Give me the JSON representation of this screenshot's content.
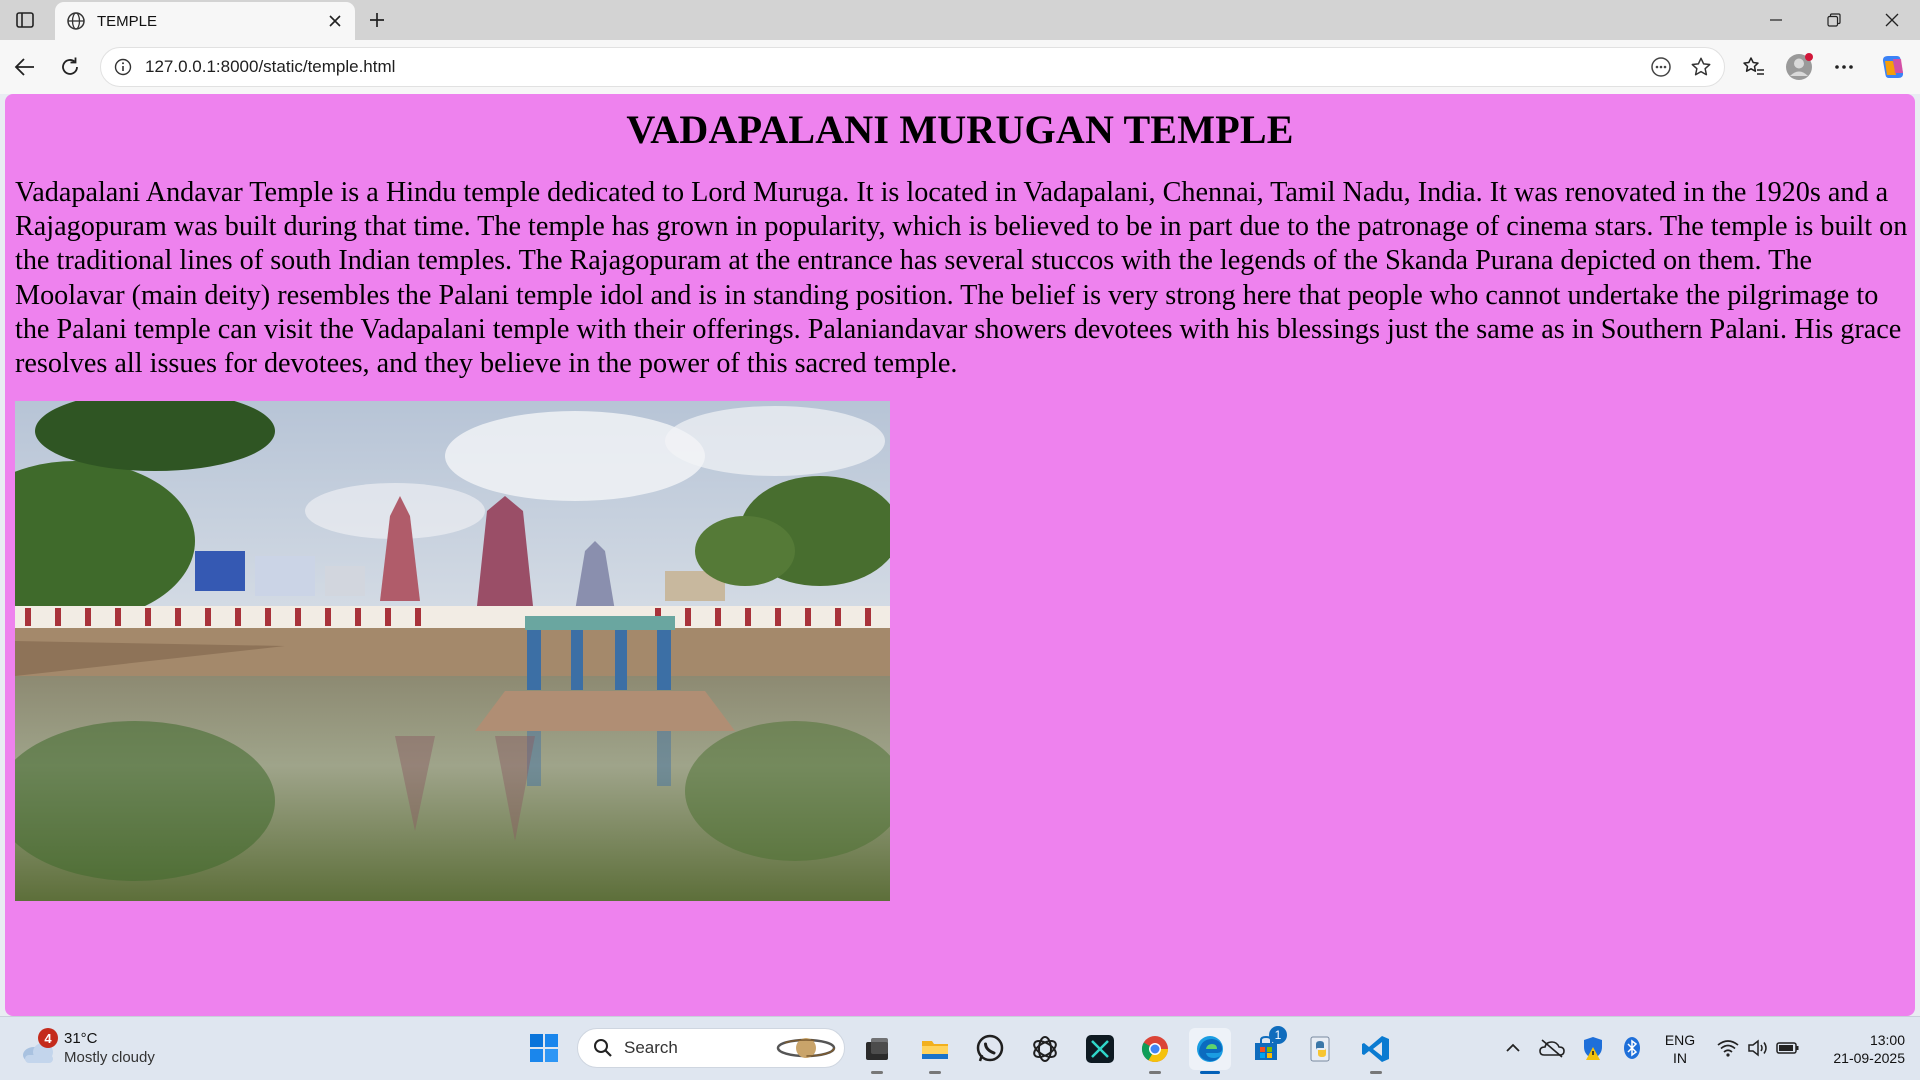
{
  "browser": {
    "tab": {
      "title": "TEMPLE"
    },
    "address_bar": {
      "url": "127.0.0.1:8000/static/temple.html"
    }
  },
  "page": {
    "background_color": "#ee82ee",
    "heading": "VADAPALANI MURUGAN TEMPLE",
    "paragraph": "Vadapalani Andavar Temple is a Hindu temple dedicated to Lord Muruga. It is located in Vadapalani, Chennai, Tamil Nadu, India. It was renovated in the 1920s and a Rajagopuram was built during that time. The temple has grown in popularity, which is believed to be in part due to the patronage of cinema stars. The temple is built on the traditional lines of south Indian temples. The Rajagopuram at the entrance has several stuccos with the legends of the Skanda Purana depicted on them. The Moolavar (main deity) resembles the Palani temple idol and is in standing position. The belief is very strong here that people who cannot undertake the pilgrimage to the Palani temple can visit the Vadapalani temple with their offerings. Palaniandavar showers devotees with his blessings just the same as in Southern Palani. His grace resolves all issues for devotees, and they believe in the power of this sacred temple."
  },
  "taskbar": {
    "weather": {
      "badge": "4",
      "temperature": "31°C",
      "condition": "Mostly cloudy"
    },
    "search": {
      "label": "Search"
    },
    "store_badge": "1",
    "language": {
      "line1": "ENG",
      "line2": "IN"
    },
    "clock": {
      "time": "13:00",
      "date": "21-09-2025"
    },
    "apps": [
      "start-icon",
      "file-manager-icon",
      "file-explorer-icon",
      "whatsapp-icon",
      "chatgpt-icon",
      "capcut-icon",
      "chrome-icon",
      "edge-icon",
      "microsoft-store-icon",
      "python-icon",
      "vscode-icon"
    ],
    "tray_icons": [
      "chevron-up-icon",
      "onedrive-icon",
      "defender-icon",
      "bluetooth-icon",
      "wifi-icon",
      "volume-icon",
      "battery-icon"
    ]
  }
}
